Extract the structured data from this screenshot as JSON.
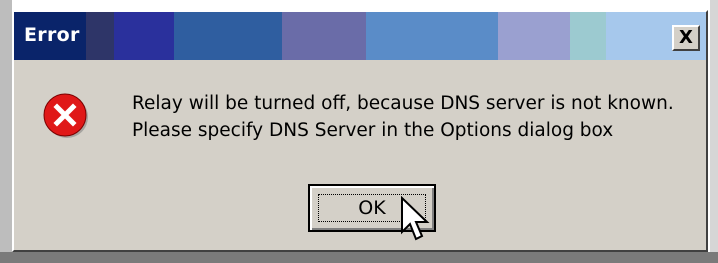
{
  "dialog": {
    "title": "Error",
    "close_label": "X",
    "message_lines": [
      "Relay will be turned off, because DNS server is not known.",
      "Please specify DNS Server in the Options dialog box"
    ],
    "ok_label": "OK",
    "icon": "error-icon"
  },
  "titlebar_colors": [
    "#0a246a",
    "#2e3568",
    "#2a309c",
    "#2f5ea0",
    "#6a6ca8",
    "#5a8cc8",
    "#9aa0d0",
    "#9ccad0",
    "#a6c8ec"
  ],
  "colors": {
    "dialog_face": "#d4d0c8",
    "error_red": "#e01818"
  }
}
